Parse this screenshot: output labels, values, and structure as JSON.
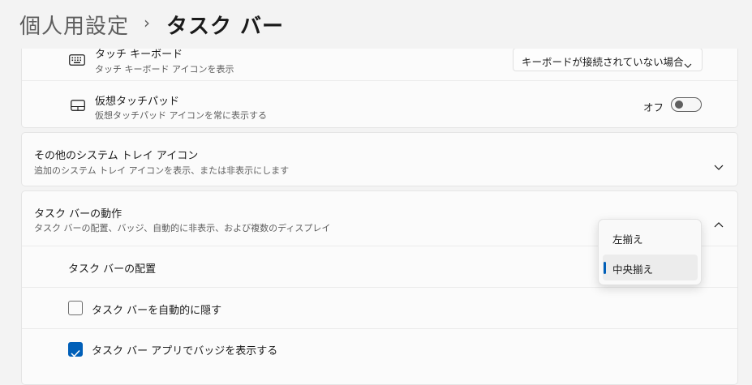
{
  "breadcrumb": {
    "parent": "個人用設定",
    "separator": "›",
    "current": "タスク バー"
  },
  "system_tray_icons": {
    "touch_keyboard": {
      "title": "タッチ キーボード",
      "description": "タッチ キーボード アイコンを表示",
      "dropdown_value": "キーボードが接続されていない場合"
    },
    "virtual_touchpad": {
      "title": "仮想タッチパッド",
      "description": "仮想タッチパッド アイコンを常に表示する",
      "toggle_state_label": "オフ",
      "toggle_on": false
    }
  },
  "other_tray_icons": {
    "title": "その他のシステム トレイ アイコン",
    "description": "追加のシステム トレイ アイコンを表示、または非表示にします"
  },
  "taskbar_behaviors": {
    "title": "タスク バーの動作",
    "description": "タスク バーの配置、バッジ、自動的に非表示、および複数のディスプレイ",
    "alignment": {
      "label": "タスク バーの配置",
      "options": [
        "左揃え",
        "中央揃え"
      ],
      "selected": "中央揃え"
    },
    "auto_hide": {
      "label": "タスク バーを自動的に隠す",
      "checked": false
    },
    "show_badges": {
      "label": "タスク バー アプリでバッジを表示する",
      "checked": true
    }
  },
  "colors": {
    "accent": "#005fb8",
    "background": "#f3f3f3",
    "card": "#fbfbfb"
  },
  "icons": [
    "keyboard-icon",
    "touchpad-icon",
    "chevron-down-icon",
    "chevron-up-icon",
    "checkmark-icon"
  ]
}
